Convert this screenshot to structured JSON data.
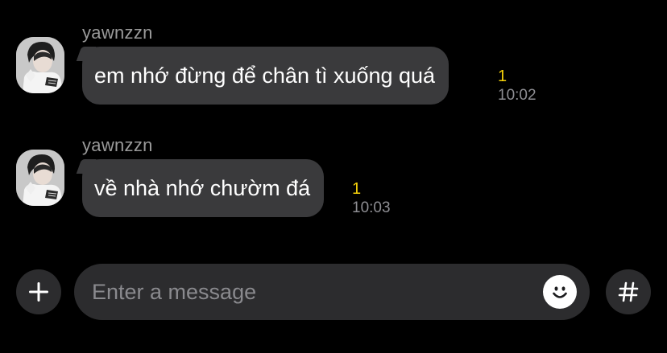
{
  "messages": [
    {
      "sender": "yawnzzn",
      "text": "em nhớ đừng để chân tì xuống quá",
      "unread": "1",
      "time": "10:02"
    },
    {
      "sender": "yawnzzn",
      "text": "về nhà nhớ chườm đá",
      "unread": "1",
      "time": "10:03"
    }
  ],
  "input": {
    "placeholder": "Enter a message"
  },
  "icons": {
    "attach": "plus-icon",
    "emoji": "smiley-icon",
    "hashtag": "hash-icon",
    "avatar": "avatar"
  },
  "colors": {
    "background": "#000000",
    "bubble": "#3a3a3c",
    "unread": "#f5d10a",
    "meta": "#8e8e93",
    "sender": "#9a9a9a"
  }
}
